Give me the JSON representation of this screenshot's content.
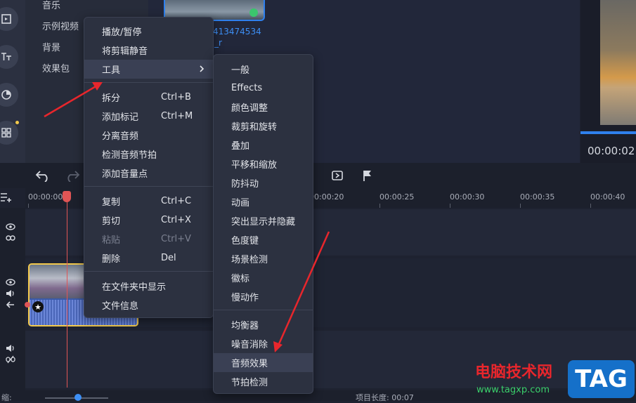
{
  "categories": [
    {
      "label": "音乐"
    },
    {
      "label": "示例视频"
    },
    {
      "label": "背景"
    },
    {
      "label": "效果包"
    }
  ],
  "media": {
    "file_name_line1": "413474534",
    "file_name_line2": "_r"
  },
  "preview": {
    "timecode": "00:00:02"
  },
  "ruler": {
    "labels": [
      "00:00:00",
      "00:00:20",
      "00:00:25",
      "00:00:30",
      "00:00:35",
      "00:00:40"
    ]
  },
  "status": {
    "left": "缩:",
    "project_length": "项目长度: 00:07"
  },
  "context_menu": {
    "items": [
      {
        "label": "播放/暂停",
        "shortcut": ""
      },
      {
        "label": "将剪辑静音",
        "shortcut": ""
      },
      {
        "label": "工具",
        "shortcut": ""
      },
      {
        "label": "拆分",
        "shortcut": "Ctrl+B"
      },
      {
        "label": "添加标记",
        "shortcut": "Ctrl+M"
      },
      {
        "label": "分离音频",
        "shortcut": ""
      },
      {
        "label": "检测音频节拍",
        "shortcut": ""
      },
      {
        "label": "添加音量点",
        "shortcut": ""
      },
      {
        "label": "复制",
        "shortcut": "Ctrl+C"
      },
      {
        "label": "剪切",
        "shortcut": "Ctrl+X"
      },
      {
        "label": "粘贴",
        "shortcut": "Ctrl+V"
      },
      {
        "label": "删除",
        "shortcut": "Del"
      },
      {
        "label": "在文件夹中显示",
        "shortcut": ""
      },
      {
        "label": "文件信息",
        "shortcut": ""
      }
    ]
  },
  "tools_submenu": {
    "items": [
      {
        "label": "一般"
      },
      {
        "label": "Effects"
      },
      {
        "label": "颜色调整"
      },
      {
        "label": "裁剪和旋转"
      },
      {
        "label": "叠加"
      },
      {
        "label": "平移和缩放"
      },
      {
        "label": "防抖动"
      },
      {
        "label": "动画"
      },
      {
        "label": "突出显示并隐藏"
      },
      {
        "label": "色度键"
      },
      {
        "label": "场景检测"
      },
      {
        "label": "徽标"
      },
      {
        "label": "慢动作"
      },
      {
        "label": "均衡器"
      },
      {
        "label": "噪音消除"
      },
      {
        "label": "音频效果"
      },
      {
        "label": "节拍检测"
      }
    ]
  },
  "watermark": {
    "site_name": "电脑技术网",
    "url": "www.tagxp.com",
    "badge": "TAG"
  },
  "colors": {
    "accent": "#2f80ed",
    "clip_border": "#f2c94c",
    "playhead": "#e05555",
    "annotation_arrow": "#e8262c"
  }
}
